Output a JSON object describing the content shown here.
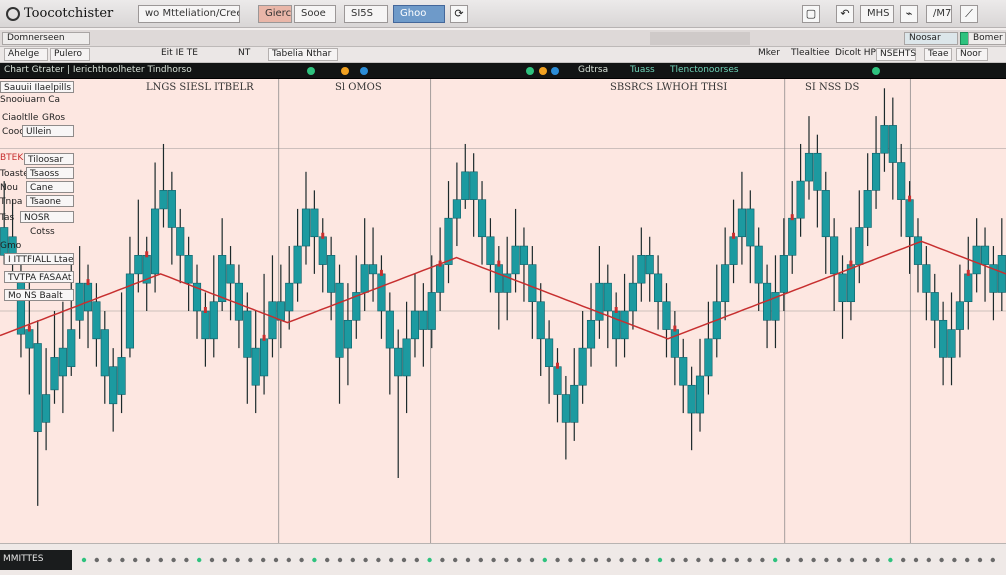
{
  "window": {
    "app_title": "Toocotchister",
    "menu": [
      "wo Mtteliation/Crees",
      "Gierc",
      "Sooe",
      "SI5S",
      "Ghoo"
    ],
    "right_labels": [
      "MHS",
      "/M7"
    ]
  },
  "toolbar2": {
    "items": [
      "Domnerseen",
      "Noosar",
      "Bomer"
    ]
  },
  "toolbar3": {
    "items": [
      "Ahelge",
      "Pulero",
      "Eit IE TE",
      "NT",
      "Tabelia Nthar",
      "Mker",
      "Tlealtiee",
      "Dicolt HP",
      "NSEHTS",
      "Teae",
      "Noor"
    ]
  },
  "chartbar": {
    "left_text": "Chart Gtrater | Ierichthoolheter Tindhorsoundg",
    "mid_text": "Gdtrsa",
    "mid_text2": "Tuass",
    "mid_text3": "Tlenctonoorses",
    "dot_colors": [
      "#2ec27e",
      "#f0a020",
      "#2b8cd6"
    ]
  },
  "chart": {
    "top_labels": [
      "LNGS SIESL ITBELR",
      "Sl OMOS",
      "SBSRCS LWHOH THSI",
      "SI NSS DS"
    ],
    "bottom_tag": "MMITTES",
    "side": {
      "header1": "Sauuii Ilaelpills",
      "header2": "Snooiuarn Ca",
      "row_a1": "Ciaoltlle",
      "row_a2": "GRos",
      "row_a3": "Cooc",
      "row_a4": "Ullein",
      "red_label": "BTEK",
      "rows": [
        "Tiloosar",
        "Toaste",
        "Tsaoss",
        "Nou",
        "Cane",
        "Tnpa",
        "Tsaone",
        "Tas",
        "Gmo",
        "NOSR",
        "Cotss"
      ],
      "footer1": "I ITTFIALL Ltae",
      "footer2": "TVTPA FASAAt",
      "footer3": "Mo NS Baalt"
    },
    "colors": {
      "background": "#fde7e1",
      "candle": "#1c9aa0",
      "candle_stroke": "#0f5d66",
      "wick": "#1c2a2b",
      "accent_red": "#c72f2f",
      "grid": "#7f7f7f"
    }
  },
  "chart_data": {
    "type": "candlestick",
    "title": "",
    "xlabel": "",
    "ylabel": "",
    "ylim": [
      0,
      100
    ],
    "candles": [
      [
        62,
        68,
        78,
        60
      ],
      [
        60,
        66,
        74,
        58
      ],
      [
        58,
        45,
        62,
        40
      ],
      [
        46,
        42,
        58,
        32
      ],
      [
        43,
        24,
        48,
        8
      ],
      [
        26,
        32,
        42,
        20
      ],
      [
        33,
        40,
        50,
        30
      ],
      [
        42,
        36,
        52,
        28
      ],
      [
        38,
        46,
        60,
        36
      ],
      [
        48,
        56,
        64,
        44
      ],
      [
        56,
        50,
        60,
        42
      ],
      [
        52,
        44,
        56,
        38
      ],
      [
        46,
        36,
        50,
        30
      ],
      [
        38,
        30,
        42,
        24
      ],
      [
        32,
        40,
        54,
        28
      ],
      [
        42,
        58,
        66,
        40
      ],
      [
        58,
        62,
        74,
        54
      ],
      [
        62,
        56,
        66,
        50
      ],
      [
        58,
        72,
        82,
        54
      ],
      [
        72,
        76,
        86,
        68
      ],
      [
        76,
        68,
        80,
        60
      ],
      [
        68,
        62,
        72,
        56
      ],
      [
        62,
        56,
        66,
        50
      ],
      [
        56,
        50,
        60,
        44
      ],
      [
        50,
        44,
        54,
        38
      ],
      [
        44,
        52,
        62,
        40
      ],
      [
        52,
        62,
        70,
        50
      ],
      [
        60,
        56,
        64,
        48
      ],
      [
        56,
        48,
        60,
        42
      ],
      [
        50,
        40,
        54,
        30
      ],
      [
        42,
        34,
        50,
        28
      ],
      [
        36,
        44,
        58,
        32
      ],
      [
        44,
        52,
        62,
        40
      ],
      [
        52,
        48,
        60,
        42
      ],
      [
        50,
        56,
        64,
        46
      ],
      [
        56,
        64,
        72,
        52
      ],
      [
        64,
        72,
        80,
        60
      ],
      [
        72,
        66,
        76,
        58
      ],
      [
        66,
        60,
        70,
        54
      ],
      [
        62,
        54,
        66,
        48
      ],
      [
        56,
        40,
        60,
        30
      ],
      [
        42,
        48,
        56,
        34
      ],
      [
        48,
        54,
        62,
        44
      ],
      [
        54,
        60,
        70,
        50
      ],
      [
        60,
        58,
        68,
        52
      ],
      [
        58,
        50,
        62,
        44
      ],
      [
        50,
        42,
        54,
        32
      ],
      [
        42,
        36,
        46,
        14
      ],
      [
        36,
        44,
        52,
        28
      ],
      [
        44,
        50,
        58,
        40
      ],
      [
        50,
        46,
        56,
        38
      ],
      [
        46,
        54,
        62,
        42
      ],
      [
        54,
        60,
        68,
        50
      ],
      [
        60,
        70,
        78,
        56
      ],
      [
        70,
        74,
        82,
        64
      ],
      [
        74,
        80,
        86,
        72
      ],
      [
        80,
        74,
        84,
        66
      ],
      [
        74,
        66,
        78,
        60
      ],
      [
        66,
        60,
        70,
        54
      ],
      [
        60,
        54,
        64,
        46
      ],
      [
        54,
        58,
        66,
        48
      ],
      [
        58,
        64,
        72,
        54
      ],
      [
        64,
        60,
        68,
        52
      ],
      [
        60,
        52,
        64,
        44
      ],
      [
        52,
        44,
        56,
        36
      ],
      [
        44,
        38,
        48,
        30
      ],
      [
        38,
        32,
        42,
        26
      ],
      [
        32,
        26,
        36,
        18
      ],
      [
        26,
        34,
        42,
        22
      ],
      [
        34,
        42,
        50,
        30
      ],
      [
        42,
        48,
        56,
        38
      ],
      [
        48,
        56,
        64,
        44
      ],
      [
        56,
        50,
        60,
        42
      ],
      [
        50,
        44,
        54,
        38
      ],
      [
        44,
        50,
        58,
        40
      ],
      [
        50,
        56,
        62,
        46
      ],
      [
        56,
        62,
        68,
        52
      ],
      [
        62,
        58,
        66,
        52
      ],
      [
        58,
        52,
        62,
        46
      ],
      [
        52,
        46,
        56,
        40
      ],
      [
        46,
        40,
        50,
        34
      ],
      [
        40,
        34,
        44,
        28
      ],
      [
        34,
        28,
        38,
        20
      ],
      [
        28,
        36,
        44,
        24
      ],
      [
        36,
        44,
        52,
        32
      ],
      [
        44,
        52,
        60,
        40
      ],
      [
        52,
        60,
        68,
        48
      ],
      [
        60,
        66,
        74,
        56
      ],
      [
        66,
        72,
        80,
        60
      ],
      [
        72,
        64,
        76,
        56
      ],
      [
        64,
        56,
        68,
        50
      ],
      [
        56,
        48,
        60,
        42
      ],
      [
        48,
        54,
        62,
        42
      ],
      [
        54,
        62,
        70,
        50
      ],
      [
        62,
        70,
        78,
        58
      ],
      [
        70,
        78,
        86,
        66
      ],
      [
        78,
        84,
        92,
        74
      ],
      [
        84,
        76,
        88,
        68
      ],
      [
        76,
        66,
        80,
        58
      ],
      [
        66,
        58,
        70,
        50
      ],
      [
        58,
        52,
        62,
        44
      ],
      [
        52,
        60,
        68,
        48
      ],
      [
        60,
        68,
        76,
        56
      ],
      [
        68,
        76,
        84,
        64
      ],
      [
        76,
        84,
        92,
        72
      ],
      [
        84,
        90,
        98,
        80
      ],
      [
        90,
        82,
        96,
        74
      ],
      [
        82,
        74,
        86,
        66
      ],
      [
        74,
        66,
        78,
        58
      ],
      [
        66,
        60,
        70,
        54
      ],
      [
        60,
        54,
        64,
        48
      ],
      [
        54,
        48,
        58,
        42
      ],
      [
        48,
        40,
        52,
        34
      ],
      [
        40,
        46,
        54,
        34
      ],
      [
        46,
        52,
        60,
        40
      ],
      [
        52,
        58,
        66,
        46
      ],
      [
        58,
        64,
        70,
        54
      ],
      [
        64,
        60,
        68,
        52
      ],
      [
        60,
        54,
        64,
        48
      ],
      [
        54,
        62,
        70,
        50
      ]
    ],
    "ma": [
      42,
      44,
      46,
      48,
      50,
      52,
      54,
      56,
      58,
      60,
      62,
      64,
      66,
      68,
      70,
      72,
      74,
      76,
      78,
      80,
      78,
      76,
      74,
      72,
      70,
      68,
      66,
      64,
      62,
      60,
      58,
      56,
      54,
      52,
      50,
      52,
      54,
      56,
      58,
      60,
      62,
      64,
      66,
      68,
      70,
      72,
      74,
      76,
      78,
      80,
      82,
      84,
      86,
      88,
      90,
      88,
      86,
      84,
      82,
      80,
      78,
      76,
      74,
      72,
      70,
      68,
      66,
      64,
      62,
      60,
      58,
      56,
      54,
      52,
      50,
      48,
      46,
      44,
      42,
      40,
      42,
      44,
      46,
      48,
      50,
      52,
      54,
      56,
      58,
      60,
      62,
      64,
      66,
      68,
      70,
      72,
      74,
      76,
      78,
      80,
      82,
      84,
      86,
      88,
      90,
      92,
      94,
      96,
      98,
      100,
      98,
      96,
      94,
      92,
      90,
      88,
      86,
      84,
      82,
      80
    ],
    "grid": true,
    "legend": "none"
  }
}
